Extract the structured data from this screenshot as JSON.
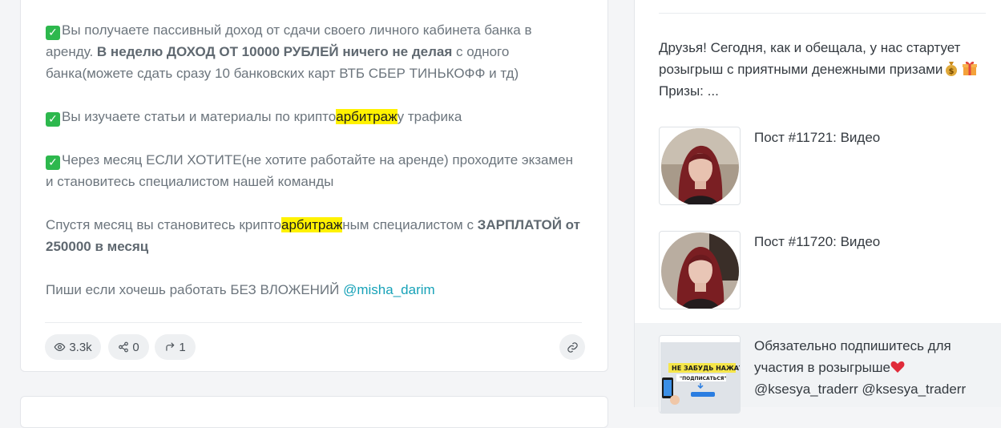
{
  "post": {
    "paragraphs": {
      "p1_a": "Вы получаете пассивный доход от сдачи своего личного кабинета банка в аренду. ",
      "p1_bold": "В неделю ДОХОД ОТ 10000 РУБЛЕЙ ничего не делая",
      "p1_b": " с одного банка(можете сдать сразу 10 банковских карт ВТБ СБЕР ТИНЬКОФФ и тд)",
      "p2_a": "Вы изучаете статьи и материалы по крипто",
      "p2_hl": "арбитраж",
      "p2_b": "у трафика",
      "p3": "Через месяц ЕСЛИ ХОТИТЕ(не хотите работайте на аренде) проходите экзамен и становитесь специалистом нашей команды",
      "p4_a": "Спустя месяц вы становитесь крипто",
      "p4_hl": "арбитраж",
      "p4_b": "ным специалистом с ",
      "p4_bold": "ЗАРПЛАТОЙ от 250000 в месяц",
      "p5_a": "Пиши если хочешь работать БЕЗ ВЛОЖЕНИЙ ",
      "p5_link": "@misha_darim"
    },
    "stats": {
      "views": "3.3k",
      "shares": "0",
      "reposts": "1"
    },
    "icons": {
      "check": "check-mark-icon",
      "views": "eye-icon",
      "shares": "share-nodes-icon",
      "reposts": "forward-arrow-icon",
      "link": "link-icon"
    }
  },
  "sidebar": {
    "intro_line1": "Друзья! Сегодня, как и обещала, у нас стартует розыгрыш с приятными денежными призами",
    "intro_line2": "Призы: ...",
    "items": [
      {
        "title": "Пост #11721: Видео"
      },
      {
        "title": "Пост #11720: Видео"
      },
      {
        "title": "Обязательно подпишитесь для участия в розыгрыше",
        "mentions": "@ksesya_traderr @ksesya_traderr",
        "promo_line1": "НЕ ЗАБУДЬ НАЖАТЬ",
        "promo_line2": "\"ПОДПИСАТЬСЯ\""
      }
    ]
  },
  "colors": {
    "highlight": "#fff200",
    "link": "#17a2b8",
    "check": "#2db84d"
  }
}
